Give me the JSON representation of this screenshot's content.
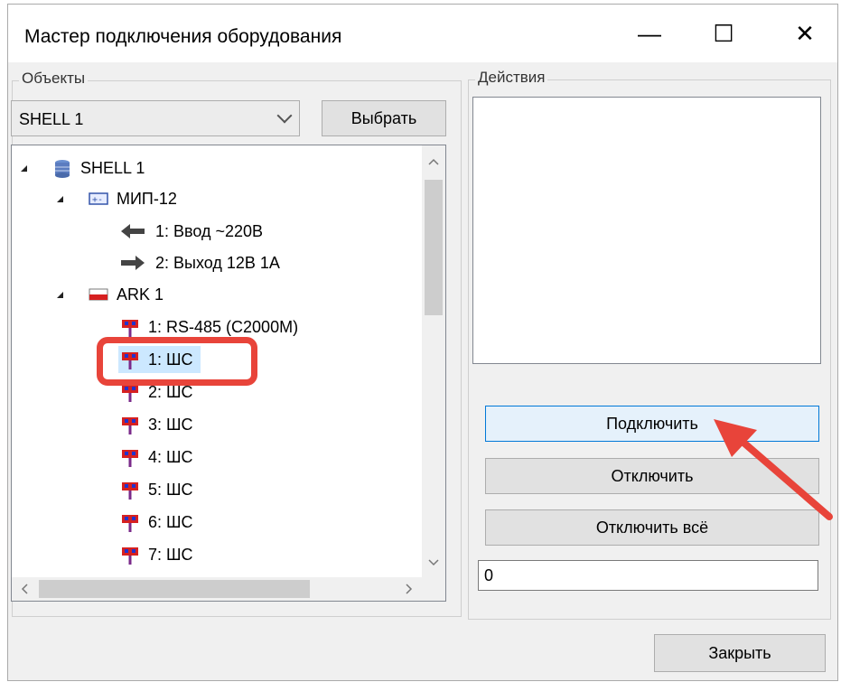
{
  "window": {
    "title": "Мастер подключения оборудования",
    "minimize_glyph": "—",
    "maximize_glyph": "☐",
    "close_glyph": "✕"
  },
  "objects_group": {
    "legend": "Объекты",
    "combo_value": "SHELL 1",
    "select_button": "Выбрать"
  },
  "tree": {
    "items": [
      {
        "label": "SHELL 1",
        "icon": "database-icon",
        "expanded": true
      },
      {
        "label": "МИП-12",
        "icon": "power-supply-icon",
        "expanded": true
      },
      {
        "label": "1: Ввод ~220В",
        "icon": "arrow-left-icon"
      },
      {
        "label": "2: Выход 12В 1А",
        "icon": "arrow-right-icon"
      },
      {
        "label": "ARK 1",
        "icon": "device-icon",
        "expanded": true
      },
      {
        "label": "1: RS-485 (C2000M)",
        "icon": "connector-icon"
      },
      {
        "label": "1: ШС",
        "icon": "connector-icon",
        "selected": true
      },
      {
        "label": "2: ШС",
        "icon": "connector-icon"
      },
      {
        "label": "3: ШС",
        "icon": "connector-icon"
      },
      {
        "label": "4: ШС",
        "icon": "connector-icon"
      },
      {
        "label": "5: ШС",
        "icon": "connector-icon"
      },
      {
        "label": "6: ШС",
        "icon": "connector-icon"
      },
      {
        "label": "7: ШС",
        "icon": "connector-icon"
      }
    ]
  },
  "actions_group": {
    "legend": "Действия",
    "connect_button": "Подключить",
    "disconnect_button": "Отключить",
    "disconnect_all_button": "Отключить всё",
    "counter_value": "0"
  },
  "footer": {
    "close_button": "Закрыть"
  },
  "colors": {
    "annotation": "#e8443a",
    "selection": "#cce8ff",
    "accent_border": "#0078d7"
  }
}
